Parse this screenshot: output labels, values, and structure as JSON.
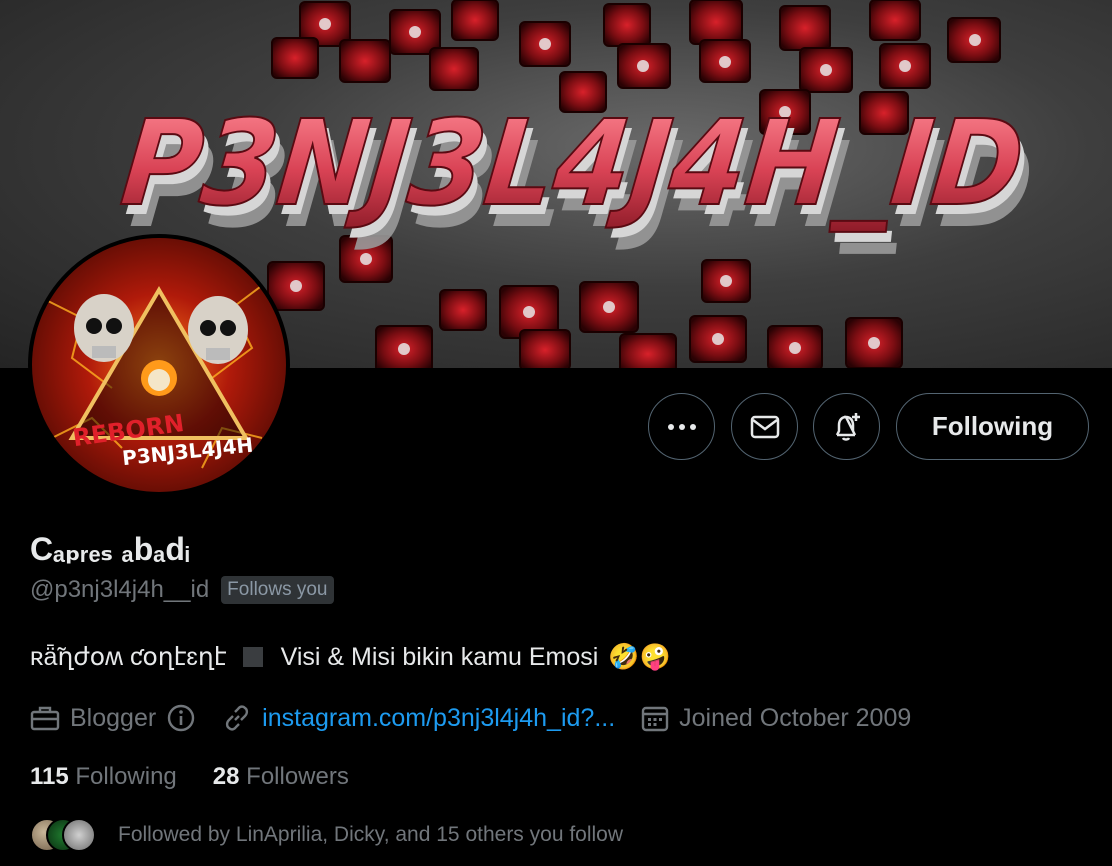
{
  "banner": {
    "title_text": "P3NJ3L4J4H_ID"
  },
  "avatar": {
    "line1": "REBORN",
    "line2": "P3NJ3L4J4H"
  },
  "actions": {
    "more_icon": "more-icon",
    "message_icon": "mail-icon",
    "notify_icon": "bell-plus-icon",
    "following_label": "Following"
  },
  "profile": {
    "display_name": "Cₐₚᵣₑₛ ₐbₐdᵢ",
    "handle": "@p3nj3l4j4h__id",
    "follows_you_badge": "Follows you",
    "bio": {
      "styled_text": "ʀǟ̃ղժօʍ ƈօղէɛղէ",
      "text": "Visi & Misi bikin kamu Emosi",
      "emojis": "🤣🤪"
    },
    "meta": {
      "category": "Blogger",
      "link": "instagram.com/p3nj3l4j4h_id?...",
      "joined": "Joined October 2009"
    },
    "stats": {
      "following_count": "115",
      "following_label": "Following",
      "followers_count": "28",
      "followers_label": "Followers"
    },
    "followed_by": "Followed by LinAprilia, Dicky, and 15 others you follow"
  },
  "colors": {
    "background": "#000000",
    "text_primary": "#e7e9ea",
    "text_secondary": "#71767b",
    "link": "#1d9bf0",
    "border": "#536471",
    "badge_bg": "#2f3336"
  }
}
